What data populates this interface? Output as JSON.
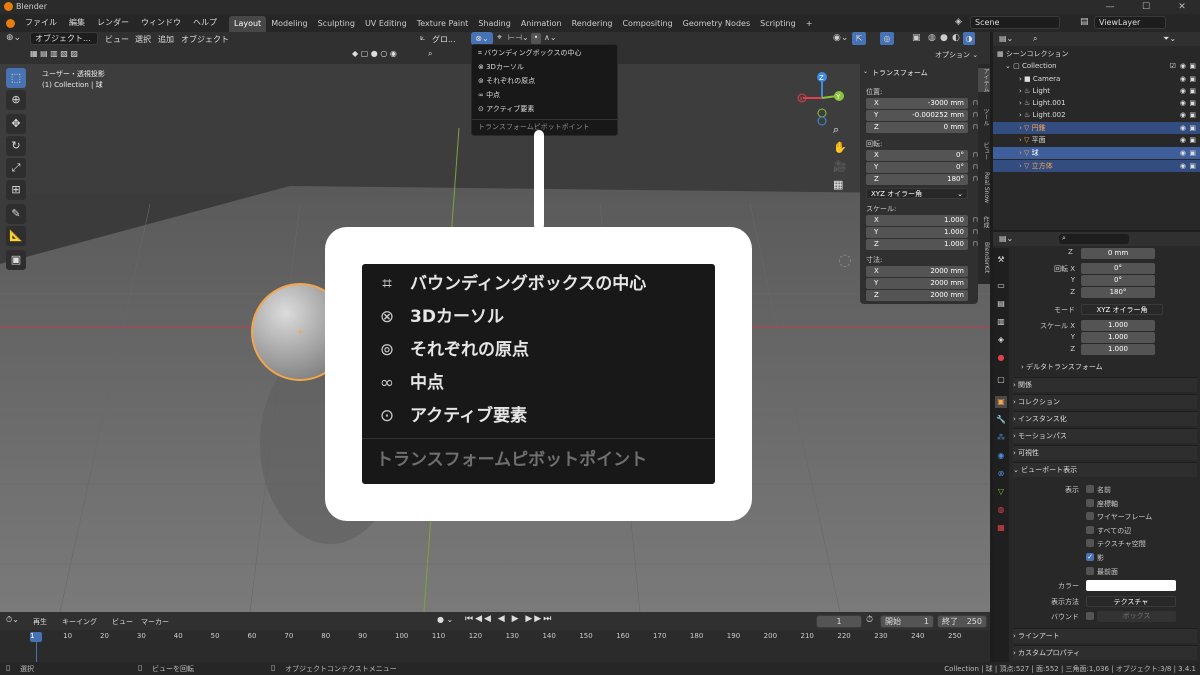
{
  "title_bar": {
    "app_title": "Blender",
    "min": "—",
    "max": "☐",
    "close": "✕"
  },
  "menu": {
    "items": [
      "ファイル",
      "編集",
      "レンダー",
      "ウィンドウ",
      "ヘルプ"
    ]
  },
  "workspaces": [
    "Layout",
    "Modeling",
    "Sculpting",
    "UV Editing",
    "Texture Paint",
    "Shading",
    "Animation",
    "Rendering",
    "Compositing",
    "Geometry Nodes",
    "Scripting"
  ],
  "active_workspace": "Layout",
  "add_workspace": "+",
  "scene": {
    "value": "Scene"
  },
  "view_layer": {
    "value": "ViewLayer"
  },
  "viewport_header": {
    "mode": "オブジェクト...",
    "menus": [
      "ビュー",
      "選択",
      "追加",
      "オブジェクト"
    ],
    "orientation": "グロ...",
    "options": "オプション ⌄"
  },
  "viewport": {
    "view_name": "ユーザー・透視投影",
    "collection_info": "(1) Collection | 球"
  },
  "gizmo": {
    "x": "X",
    "y": "Y",
    "z": "Z"
  },
  "pivot_menu": {
    "items": [
      {
        "label": "バウンディングボックスの中心",
        "icon": "bounding-box-center-icon"
      },
      {
        "label": "3Dカーソル",
        "icon": "cursor-3d-icon"
      },
      {
        "label": "それぞれの原点",
        "icon": "individual-origins-icon"
      },
      {
        "label": "中点",
        "icon": "median-point-icon"
      },
      {
        "label": "アクティブ要素",
        "icon": "active-element-icon"
      }
    ],
    "footer": "トランスフォームピボットポイント"
  },
  "transform_panel": {
    "title": "トランスフォーム",
    "location_label": "位置:",
    "location": [
      {
        "axis": "X",
        "value": "-3000 mm"
      },
      {
        "axis": "Y",
        "value": "-0.000252 mm"
      },
      {
        "axis": "Z",
        "value": "0 mm"
      }
    ],
    "rotation_label": "回転:",
    "rotation": [
      {
        "axis": "X",
        "value": "0°"
      },
      {
        "axis": "Y",
        "value": "0°"
      },
      {
        "axis": "Z",
        "value": "180°"
      }
    ],
    "rotation_mode": "XYZ オイラー角",
    "scale_label": "スケール:",
    "scale": [
      {
        "axis": "X",
        "value": "1.000"
      },
      {
        "axis": "Y",
        "value": "1.000"
      },
      {
        "axis": "Z",
        "value": "1.000"
      }
    ],
    "dimensions_label": "寸法:",
    "dimensions": [
      {
        "axis": "X",
        "value": "2000 mm"
      },
      {
        "axis": "Y",
        "value": "2000 mm"
      },
      {
        "axis": "Z",
        "value": "2000 mm"
      }
    ]
  },
  "sidebar_tabs": [
    "アイテム",
    "ツール",
    "ビュー",
    "Real Snow",
    "作成",
    "BlenderKit"
  ],
  "outliner": {
    "title": "シーンコレクション",
    "items": [
      {
        "name": "Collection",
        "level": 0,
        "selected": false
      },
      {
        "name": "Camera",
        "level": 1,
        "selected": false
      },
      {
        "name": "Light",
        "level": 1,
        "selected": false
      },
      {
        "name": "Light.001",
        "level": 1,
        "selected": false
      },
      {
        "name": "Light.002",
        "level": 1,
        "selected": false
      },
      {
        "name": "円錐",
        "level": 1,
        "selected": true
      },
      {
        "name": "平面",
        "level": 1,
        "selected": false
      },
      {
        "name": "球",
        "level": 1,
        "selected": true
      },
      {
        "name": "立方体",
        "level": 1,
        "selected": true
      }
    ]
  },
  "properties": {
    "top_z": "0 mm",
    "rotation": [
      {
        "label": "回転 X",
        "value": "0°"
      },
      {
        "label": "Y",
        "value": "0°"
      },
      {
        "label": "Z",
        "value": "180°"
      }
    ],
    "mode_label": "モード",
    "mode_value": "XYZ オイラー角",
    "scale": [
      {
        "label": "スケール X",
        "value": "1.000"
      },
      {
        "label": "Y",
        "value": "1.000"
      },
      {
        "label": "Z",
        "value": "1.000"
      }
    ],
    "sections": [
      "デルタトランスフォーム",
      "関係",
      "コレクション",
      "インスタンス化",
      "モーションパス",
      "可視性",
      "ビューポート表示"
    ],
    "display_label": "表示",
    "checkboxes": [
      {
        "label": "名前",
        "checked": false
      },
      {
        "label": "座標軸",
        "checked": false
      },
      {
        "label": "ワイヤーフレーム",
        "checked": false
      },
      {
        "label": "すべての辺",
        "checked": false
      },
      {
        "label": "テクスチャ空間",
        "checked": false
      },
      {
        "label": "影",
        "checked": true
      },
      {
        "label": "最前面",
        "checked": false
      }
    ],
    "color_label": "カラー",
    "display_as_label": "表示方法",
    "display_as_value": "テクスチャ",
    "bounds_label": "バウンド",
    "bounds_value": "ボックス",
    "bottom_sections": [
      "ラインアート",
      "カスタムプロパティ"
    ]
  },
  "timeline": {
    "menus": [
      "再生",
      "キーイング",
      "ビュー",
      "マーカー"
    ],
    "current_frame": "1",
    "start_label": "開始",
    "start": "1",
    "end_label": "終了",
    "end": "250",
    "ticks": [
      "1",
      "10",
      "20",
      "30",
      "40",
      "50",
      "60",
      "70",
      "80",
      "90",
      "100",
      "110",
      "120",
      "130",
      "140",
      "150",
      "160",
      "170",
      "180",
      "190",
      "200",
      "210",
      "220",
      "230",
      "240",
      "250"
    ]
  },
  "status": {
    "select": "選択",
    "rotate": "ビューを回転",
    "context": "オブジェクトコンテクストメニュー",
    "info": "Collection | 球 | 頂点:527 | 面:552 | 三角面:1,036 | オブジェクト:3/8 | 3.4.1"
  },
  "colors": {
    "accent": "#4772b3",
    "selection": "#f5a54a",
    "x_axis": "#e0404a",
    "y_axis": "#8bc33a",
    "z_axis": "#3d8ce0"
  }
}
